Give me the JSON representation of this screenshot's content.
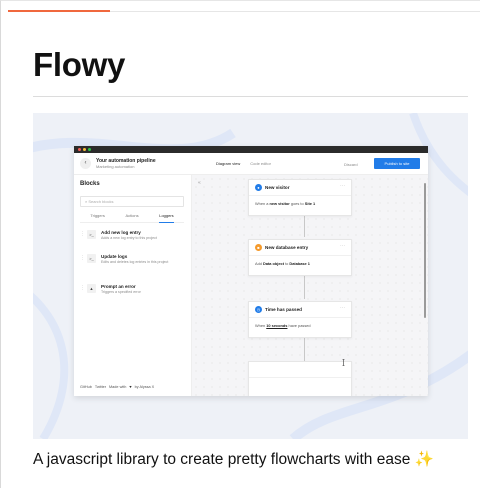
{
  "page": {
    "title": "Flowy",
    "caption": "A javascript library to create pretty flowcharts with ease ✨"
  },
  "colors": {
    "accent": "#f0683e",
    "primary_button": "#217ce8",
    "hero_background": "#eef1f7",
    "window_bar": "#2b2b2b"
  },
  "screenshot": {
    "window_dots": [
      "#f35c55",
      "#f6be3b",
      "#2ac444"
    ],
    "header": {
      "back_icon": "chevron-left-icon",
      "pipeline_title": "Your automation pipeline",
      "pipeline_subtitle": "Marketing automation",
      "view_diagram": "Diagram view",
      "view_code": "Code editor",
      "discard": "Discard",
      "publish": "Publish to site"
    },
    "sidebar": {
      "title": "Blocks",
      "collapse_icon": "«",
      "search_placeholder": "Search blocks",
      "tabs": [
        "Triggers",
        "Actions",
        "Loggers"
      ],
      "active_tab": "Loggers",
      "items": [
        {
          "icon": ">_",
          "title": "Add new log entry",
          "description": "Adds a new log entry to this project"
        },
        {
          "icon": ">_",
          "title": "Update logs",
          "description": "Edits and deletes log entries in this project"
        },
        {
          "icon": "▲",
          "title": "Prompt an error",
          "description": "Triggers a specified error"
        }
      ],
      "footer": {
        "github": "GitHub",
        "twitter": "Twitter",
        "made_with": "Made with",
        "heart": "♥",
        "by": "by Alyssa X"
      }
    },
    "canvas": {
      "nodes": [
        {
          "icon": "eye-icon",
          "icon_color": "#217ce8",
          "title": "New visitor",
          "body_parts": [
            "When a ",
            "new visitor",
            " goes to ",
            "Site 1"
          ]
        },
        {
          "icon": "database-icon",
          "icon_color": "#f59a2b",
          "title": "New database entry",
          "body_parts": [
            "Add ",
            "Data object",
            " to ",
            "Database 1"
          ]
        },
        {
          "icon": "clock-icon",
          "icon_color": "#217ce8",
          "title": "Time has passed",
          "body_parts": [
            "When ",
            "10 seconds",
            " have passed",
            ""
          ]
        }
      ]
    }
  }
}
